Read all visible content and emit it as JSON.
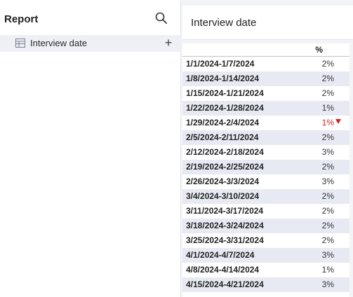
{
  "left_panel": {
    "title": "Report",
    "field": {
      "label": "Interview date"
    },
    "icons": {
      "search": "search-icon",
      "table": "table-icon",
      "add": "plus-icon"
    },
    "add_glyph": "+"
  },
  "right_panel": {
    "title": "Interview date",
    "column_header": "%",
    "rows": [
      {
        "label": "1/1/2024-1/7/2024",
        "value": "2%"
      },
      {
        "label": "1/8/2024-1/14/2024",
        "value": "2%"
      },
      {
        "label": "1/15/2024-1/21/2024",
        "value": "2%"
      },
      {
        "label": "1/22/2024-1/28/2024",
        "value": "1%"
      },
      {
        "label": "1/29/2024-2/4/2024",
        "value": "1%",
        "indicator": "down"
      },
      {
        "label": "2/5/2024-2/11/2024",
        "value": "2%"
      },
      {
        "label": "2/12/2024-2/18/2024",
        "value": "3%"
      },
      {
        "label": "2/19/2024-2/25/2024",
        "value": "2%"
      },
      {
        "label": "2/26/2024-3/3/2024",
        "value": "3%"
      },
      {
        "label": "3/4/2024-3/10/2024",
        "value": "2%"
      },
      {
        "label": "3/11/2024-3/17/2024",
        "value": "2%"
      },
      {
        "label": "3/18/2024-3/24/2024",
        "value": "2%"
      },
      {
        "label": "3/25/2024-3/31/2024",
        "value": "2%"
      },
      {
        "label": "4/1/2024-4/7/2024",
        "value": "3%"
      },
      {
        "label": "4/8/2024-4/14/2024",
        "value": "1%"
      },
      {
        "label": "4/15/2024-4/21/2024",
        "value": "3%"
      }
    ]
  },
  "colors": {
    "alt_row": "#e8eaf3",
    "negative": "#d92020"
  }
}
